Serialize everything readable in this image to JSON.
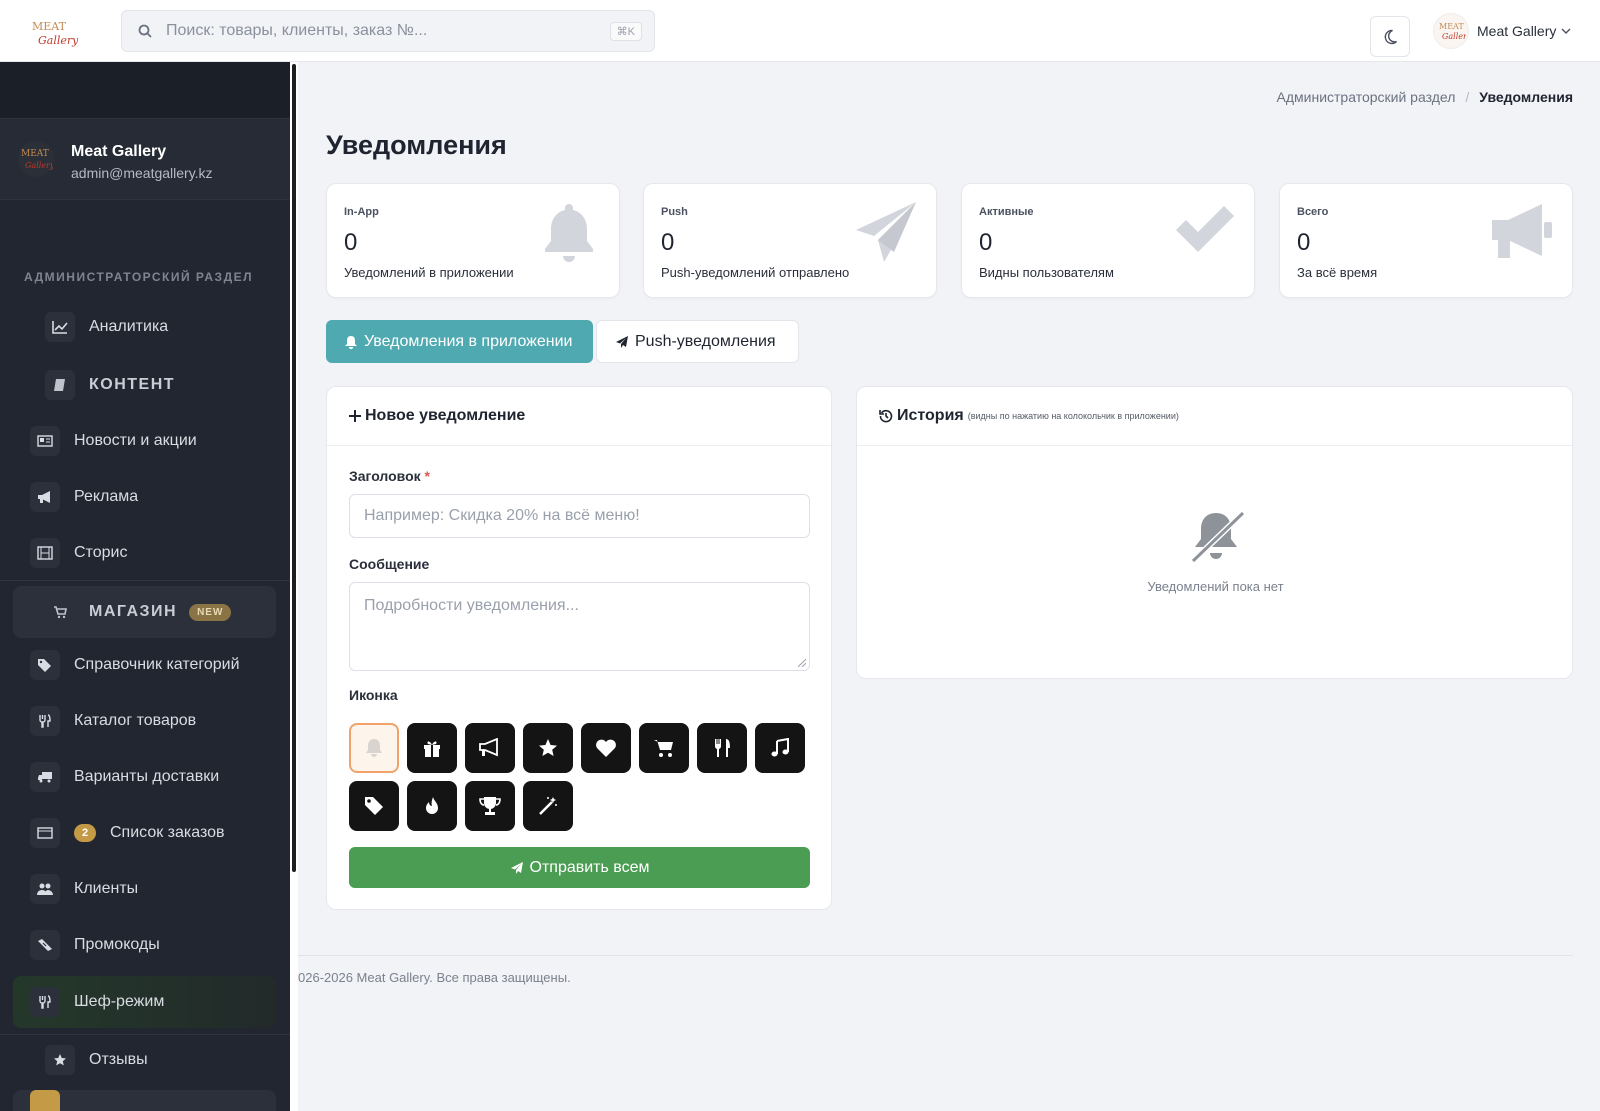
{
  "topbar": {
    "logo_alt": "Meat Gallery",
    "search_placeholder": "Поиск: товары, клиенты, заказ №...",
    "search_shortcut": "⌘K",
    "user_name": "Meat Gallery"
  },
  "sidebar": {
    "profile_name": "Meat Gallery",
    "profile_email": "admin@meatgallery.kz",
    "section_title": "АДМИНИСТРАТОРСКИЙ РАЗДЕЛ",
    "items": [
      {
        "label": "Аналитика",
        "icon": "chart-line-icon"
      },
      {
        "label": "КОНТЕНТ",
        "icon": "book-icon"
      },
      {
        "label": "Новости и акции",
        "icon": "newspaper-icon"
      },
      {
        "label": "Реклама",
        "icon": "megaphone-icon"
      },
      {
        "label": "Сторис",
        "icon": "film-icon"
      },
      {
        "label": "МАГАЗИН",
        "icon": "cart-icon",
        "badge": "NEW"
      },
      {
        "label": "Справочник категорий",
        "icon": "tags-icon"
      },
      {
        "label": "Каталог товаров",
        "icon": "utensils-icon"
      },
      {
        "label": "Варианты доставки",
        "icon": "truck-icon"
      },
      {
        "label": "Список заказов",
        "icon": "list-icon",
        "count": "2"
      },
      {
        "label": "Клиенты",
        "icon": "users-icon"
      },
      {
        "label": "Промокоды",
        "icon": "ticket-icon"
      },
      {
        "label": "Шеф-режим",
        "icon": "utensils-icon"
      },
      {
        "label": "Отзывы",
        "icon": "star-icon"
      }
    ]
  },
  "breadcrumb": {
    "parent": "Администраторский раздел",
    "separator": "/",
    "current": "Уведомления"
  },
  "page_title": "Уведомления",
  "stats": [
    {
      "title": "In-App",
      "value": "0",
      "desc": "Уведомлений в приложении",
      "icon": "bell-icon"
    },
    {
      "title": "Push",
      "value": "0",
      "desc": "Push-уведомлений отправлено",
      "icon": "paper-plane-icon"
    },
    {
      "title": "Активные",
      "value": "0",
      "desc": "Видны пользователям",
      "icon": "check-icon"
    },
    {
      "title": "Всего",
      "value": "0",
      "desc": "За всё время",
      "icon": "megaphone-icon"
    }
  ],
  "tabs": [
    {
      "label": "Уведомления в приложении",
      "active": true
    },
    {
      "label": "Push-уведомления",
      "active": false
    }
  ],
  "form": {
    "header": "Новое уведомление",
    "title_label": "Заголовок",
    "required_mark": "*",
    "title_placeholder": "Например: Скидка 20% на всё меню!",
    "message_label": "Сообщение",
    "message_placeholder": "Подробности уведомления...",
    "icon_label": "Иконка",
    "icons": [
      "bell-icon",
      "gift-icon",
      "megaphone-icon",
      "star-icon",
      "heart-icon",
      "cart-icon",
      "utensils-icon",
      "music-icon",
      "tag-icon",
      "fire-icon",
      "trophy-icon",
      "magic-wand-icon"
    ],
    "selected_icon": "bell-icon",
    "submit_label": "Отправить всем"
  },
  "history": {
    "header": "История",
    "note": "(видны по нажатию на колокольчик в приложении)",
    "empty_text": "Уведомлений пока нет"
  },
  "footer": {
    "text": "026-2026 Meat Gallery. Все права защищены."
  },
  "colors": {
    "sidebar_bg": "#212630",
    "accent_teal": "#4eaab0",
    "send_green": "#4a9d52",
    "badge_gold": "#c59a46",
    "selected_icon_border": "#f0a26a"
  }
}
